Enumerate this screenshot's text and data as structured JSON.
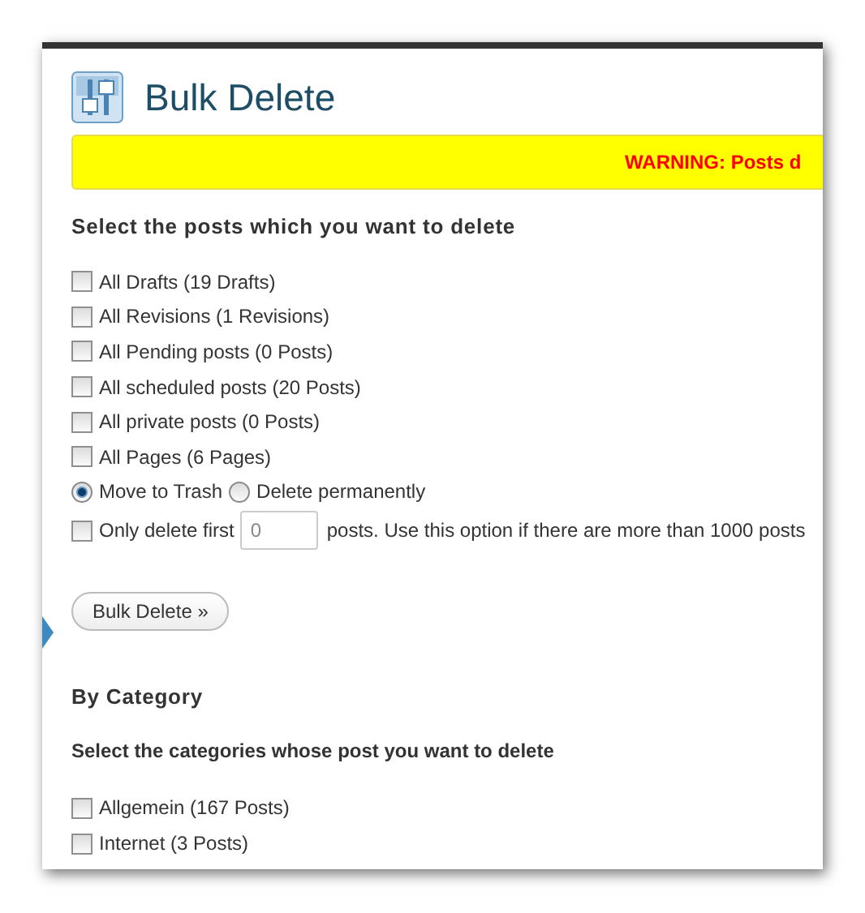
{
  "page": {
    "title": "Bulk Delete",
    "warning": "WARNING: Posts d"
  },
  "posts_section": {
    "heading": "Select the posts which you want to delete",
    "options": [
      {
        "label": "All Drafts (19 Drafts)",
        "checked": false
      },
      {
        "label": "All Revisions (1 Revisions)",
        "checked": false
      },
      {
        "label": "All Pending posts (0 Posts)",
        "checked": false
      },
      {
        "label": "All scheduled posts (20 Posts)",
        "checked": false
      },
      {
        "label": "All private posts (0 Posts)",
        "checked": false
      },
      {
        "label": "All Pages (6 Pages)",
        "checked": false
      }
    ],
    "delete_mode": [
      {
        "label": "Move to Trash",
        "selected": true
      },
      {
        "label": "Delete permanently",
        "selected": false
      }
    ],
    "limit": {
      "checked": false,
      "prefix": "Only delete first",
      "value": "0",
      "suffix": "posts. Use this option if there are more than 1000 posts"
    },
    "button": "Bulk Delete »"
  },
  "category_section": {
    "heading": "By Category",
    "subheading": "Select the categories whose post you want to delete",
    "categories": [
      {
        "label": "Allgemein (167 Posts)",
        "checked": false
      },
      {
        "label": "Internet (3 Posts)",
        "checked": false
      }
    ]
  }
}
